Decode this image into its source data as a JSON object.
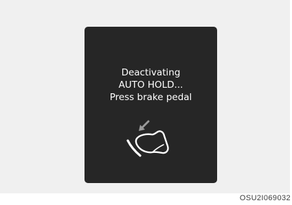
{
  "display": {
    "message_lines": [
      "Deactivating",
      "AUTO HOLD...",
      "Press brake pedal"
    ],
    "icon": "foot-pressing-brake-pedal-icon",
    "background_color": "#262626",
    "text_color": "#ffffff"
  },
  "figure": {
    "code": "OSU2I069032"
  }
}
